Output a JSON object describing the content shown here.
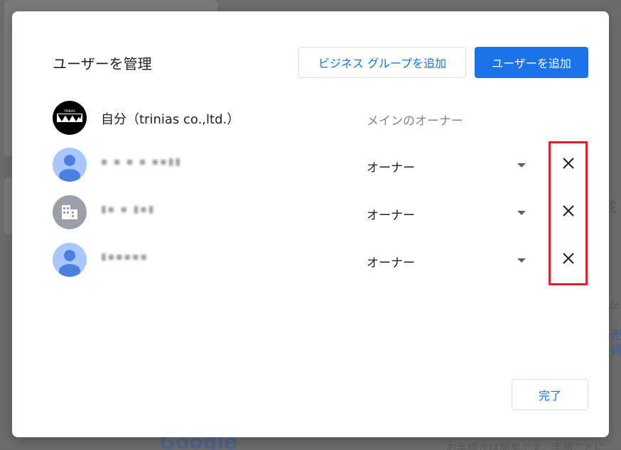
{
  "dialog": {
    "title": "ユーザーを管理",
    "add_business_group_label": "ビジネス グループを追加",
    "add_user_label": "ユーザーを追加",
    "done_label": "完了"
  },
  "users": [
    {
      "avatar": "trinias-logo",
      "name": "自分（trinias co.,ltd.）",
      "role": "メインのオーナー",
      "removable": false
    },
    {
      "avatar": "person-icon",
      "name": "▪ ▪ ▪ ▪ ▪▪▮▮",
      "role": "オーナー",
      "removable": true
    },
    {
      "avatar": "building-icon",
      "name": "▮▪ ▪ ▮▪▮",
      "role": "オーナー",
      "removable": true
    },
    {
      "avatar": "person-icon",
      "name": "▮▪▪▪▪▪",
      "role": "オーナー",
      "removable": true
    }
  ],
  "logo_text": "TRINIAS",
  "background": {
    "google": "Google",
    "snippet_bottom": "お手続きは簡単です。手順ごとに",
    "snippet_right_1": "成",
    "snippet_right_2": "co",
    "snippet_right_3": "売",
    "snippet_right_4": "資"
  },
  "colors": {
    "primary": "#1a73e8",
    "highlight": "#e0202a"
  }
}
